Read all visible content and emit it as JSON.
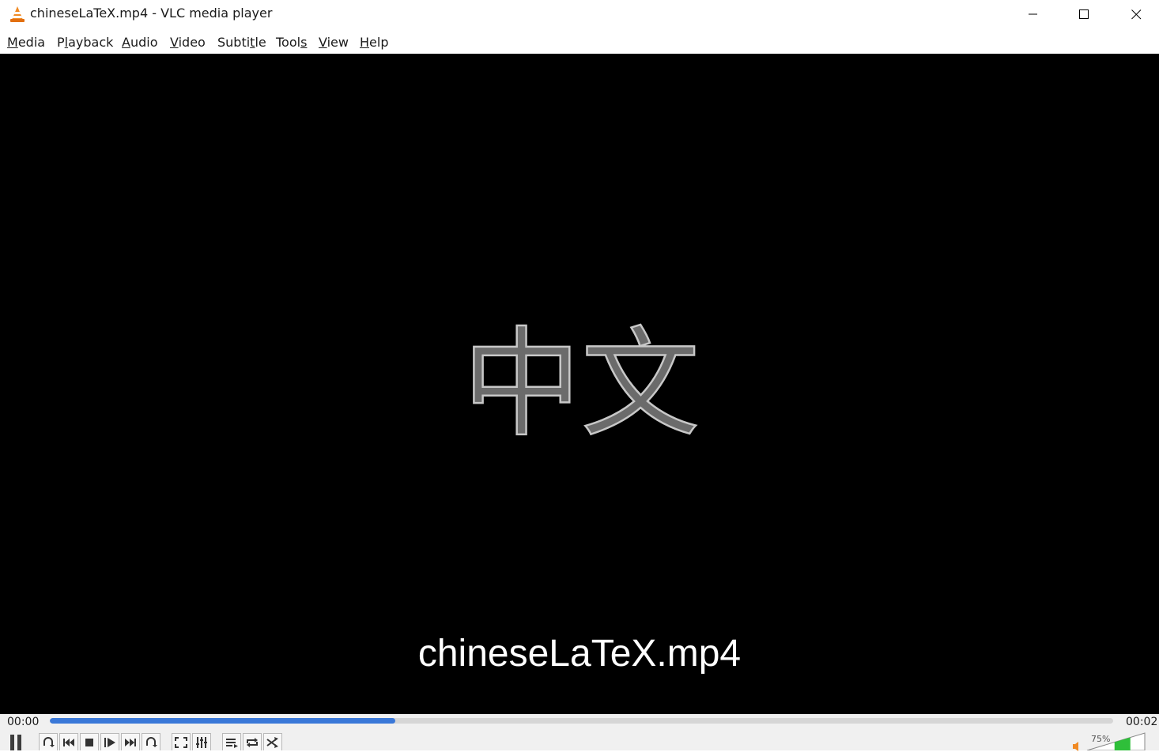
{
  "window": {
    "title": "chineseLaTeX.mp4 - VLC media player",
    "icon": "vlc-cone-icon"
  },
  "menu": {
    "items": [
      {
        "label_pre": "",
        "mnemonic": "M",
        "label_post": "edia"
      },
      {
        "label_pre": "P",
        "mnemonic": "l",
        "label_post": "ayback"
      },
      {
        "label_pre": "",
        "mnemonic": "A",
        "label_post": "udio"
      },
      {
        "label_pre": "",
        "mnemonic": "V",
        "label_post": "ideo"
      },
      {
        "label_pre": "Subti",
        "mnemonic": "t",
        "label_post": "le"
      },
      {
        "label_pre": "Tool",
        "mnemonic": "s",
        "label_post": ""
      },
      {
        "label_pre": "",
        "mnemonic": "V",
        "label_post": "iew"
      },
      {
        "label_pre": "",
        "mnemonic": "H",
        "label_post": "elp"
      }
    ]
  },
  "video": {
    "frame_text": "中文",
    "osd_filename": "chineseLaTeX.mp4"
  },
  "seek": {
    "elapsed": "00:00",
    "total": "00:02",
    "progress": 0.325
  },
  "controls": {
    "volume_label": "75%",
    "volume_level": 0.75,
    "buttons": [
      "pause-icon",
      "loop-ab-icon",
      "previous-icon",
      "stop-icon",
      "frame-step-icon",
      "next-icon",
      "loop-icon",
      "fullscreen-icon",
      "extended-settings-icon",
      "playlist-icon",
      "repeat-icon",
      "shuffle-icon"
    ]
  },
  "colors": {
    "accent": "#3a78d8",
    "vlc_orange": "#f08a24",
    "volume_green": "#2fbf3a"
  }
}
